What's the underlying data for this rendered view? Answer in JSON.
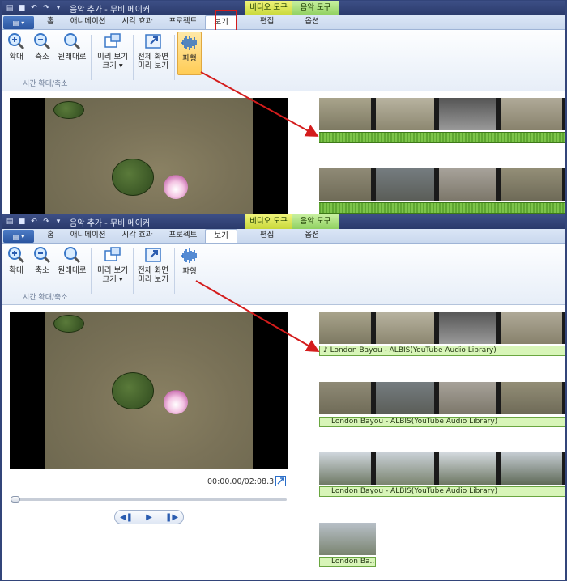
{
  "window": {
    "title": "음악 추가 - 무비 메이커"
  },
  "context_tabs": {
    "video_tools": "비디오 도구",
    "music_tools": "음악 도구"
  },
  "tabs": {
    "home": "홈",
    "animation": "애니메이션",
    "visual_effects": "시각 효과",
    "project": "프로젝트",
    "view": "보기",
    "edit": "편집",
    "options": "옵션"
  },
  "ribbon": {
    "zoom_in": "확대",
    "zoom_out": "축소",
    "reset_zoom": "원래대로",
    "preview_size": "미리 보기",
    "preview_size2": "크기 ▾",
    "fullscreen": "전체 화면",
    "fullscreen2": "미리 보기",
    "waveform": "파형",
    "group_zoom": "시간 확대/축소"
  },
  "player": {
    "time": "00:00.00/02:08.31",
    "prev_icon": "prev-frame-icon",
    "play_icon": "play-icon",
    "next_icon": "next-frame-icon"
  },
  "timeline": {
    "audio_label_1": "London Bayou - ALBIS(YouTube Audio Library)",
    "audio_label_2": "London Bayou - ALBIS(YouTube Audio Library)",
    "audio_label_3": "London Bayou - ALBIS(YouTube Audio Library)",
    "audio_label_4": "London Ba..."
  },
  "colors": {
    "accent": "#d41c1c",
    "waveform": "#5fa632",
    "audio_bar": "#d8f5b8"
  }
}
